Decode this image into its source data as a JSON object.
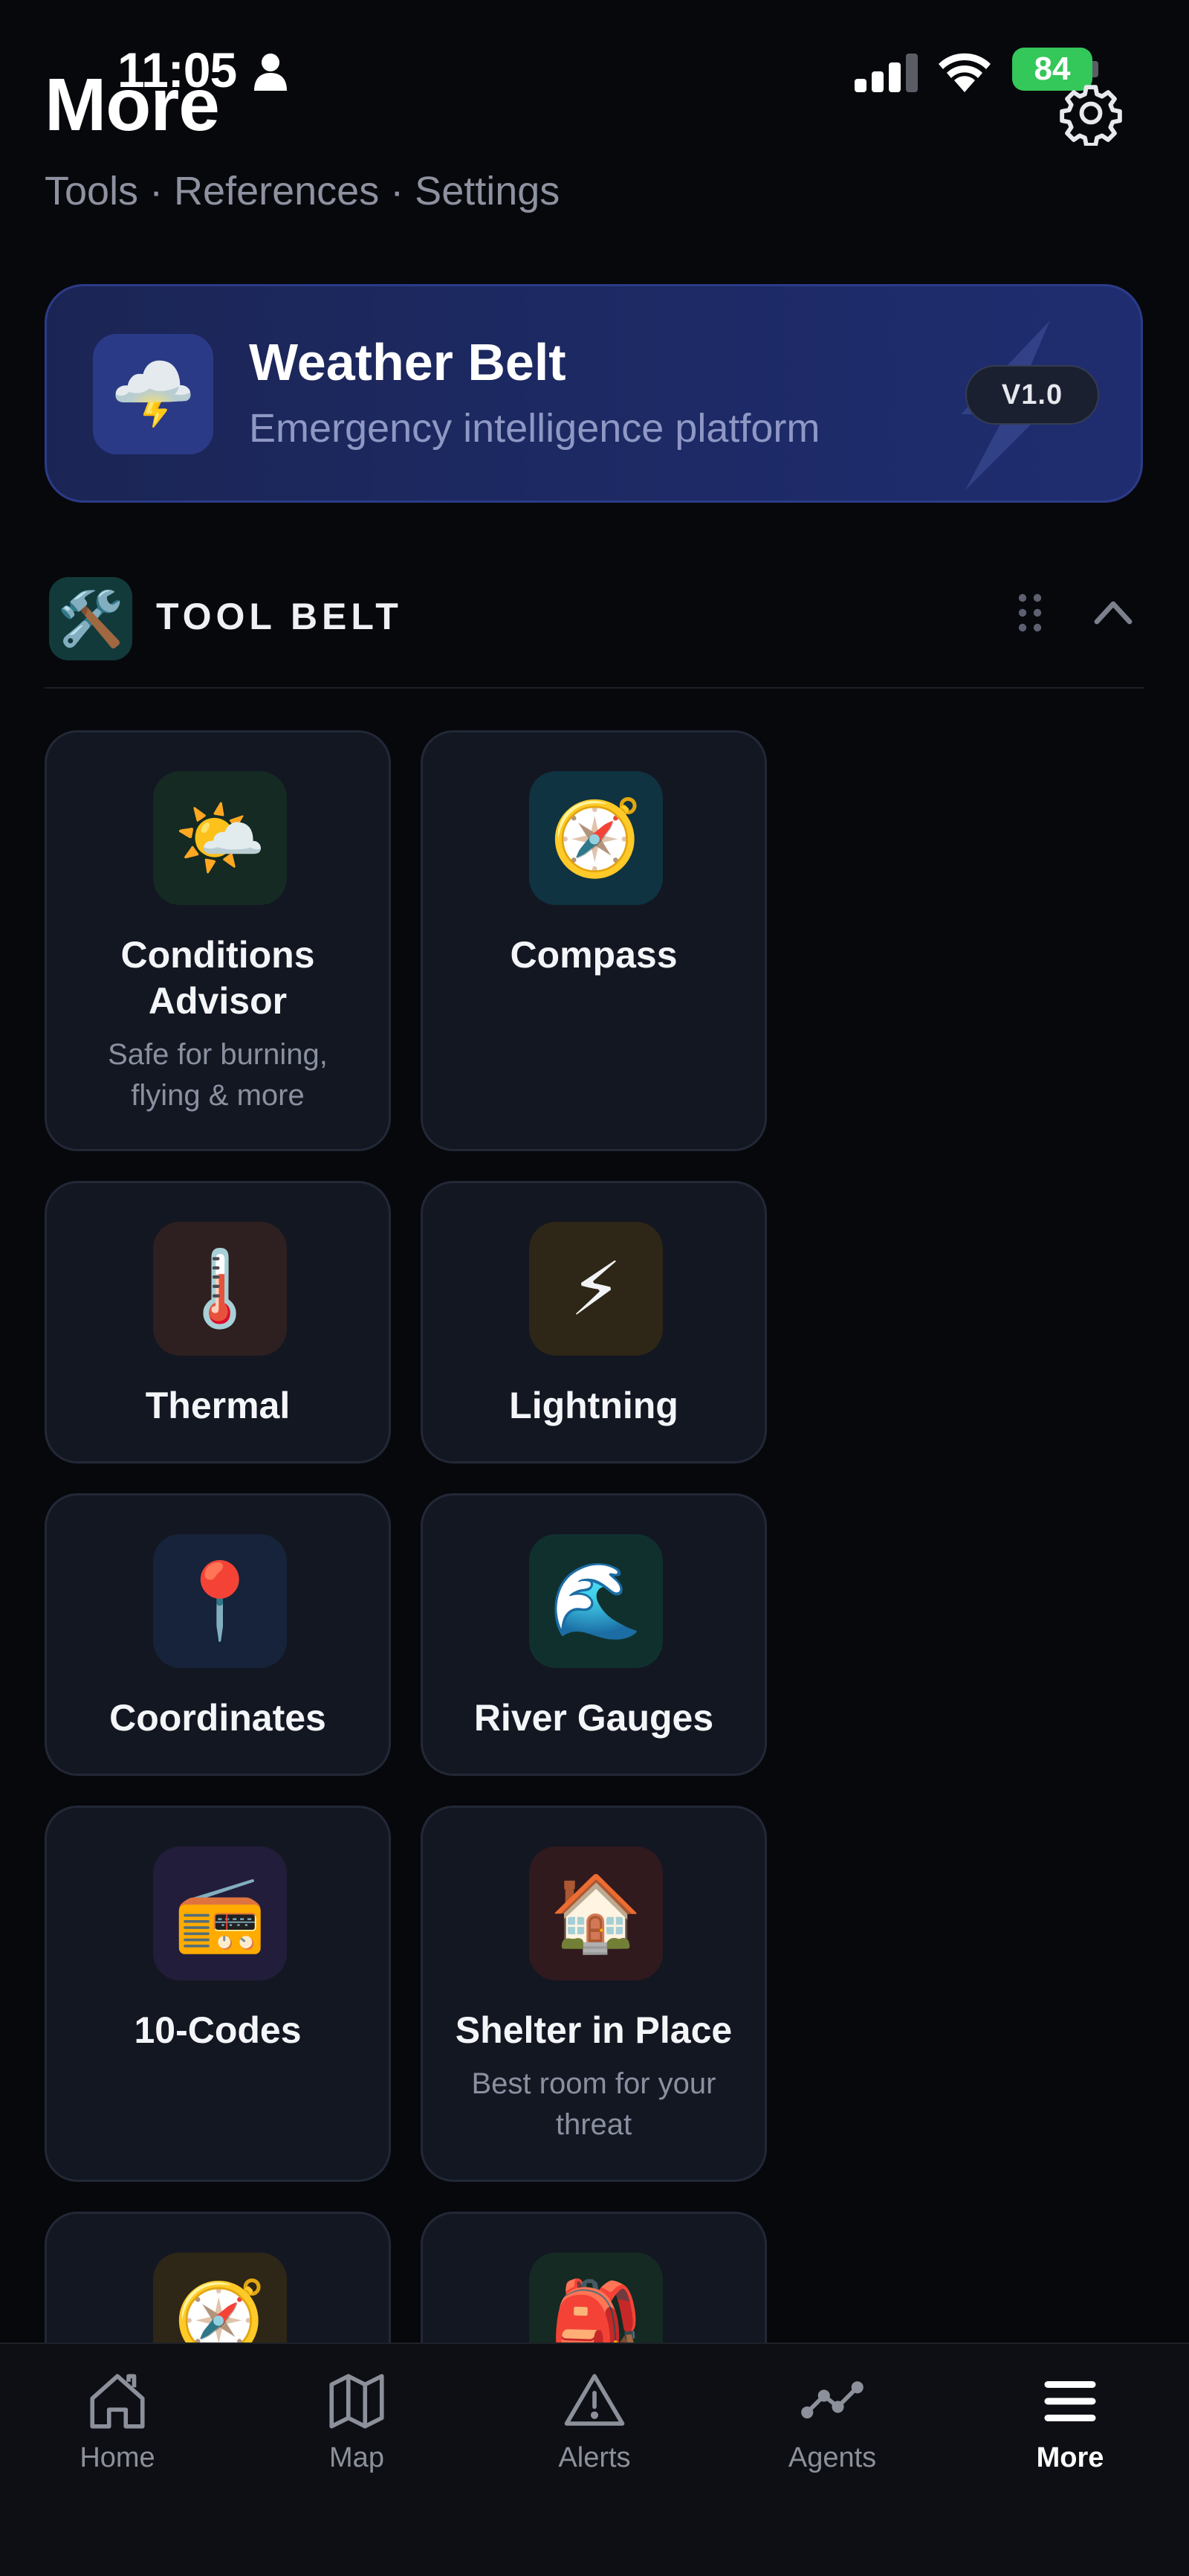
{
  "status_bar": {
    "time": "11:05",
    "battery": "84",
    "icons": [
      "person-icon",
      "cellular-signal-icon",
      "wifi-icon",
      "battery-charging-icon"
    ]
  },
  "header": {
    "title": "More",
    "subtitle": "Tools · References · Settings",
    "settings_icon": "gear-icon"
  },
  "banner": {
    "title": "Weather Belt",
    "subtitle": "Emergency intelligence platform",
    "version": "V1.0",
    "icon": "cloud-lightning-icon",
    "emoji": "🌩️"
  },
  "section": {
    "title": "TOOL BELT",
    "icon": "hammer-wrench-icon",
    "emoji": "🛠️",
    "collapsed": false
  },
  "tools": [
    {
      "name": "Conditions\nAdvisor",
      "desc": "Safe for burning, flying & more",
      "emoji": "🌤️",
      "icon": "sun-cloud-icon",
      "tile": "#142a22"
    },
    {
      "name": "Compass",
      "desc": "",
      "emoji": "🧭",
      "icon": "compass-icon",
      "tile": "#0f3340"
    },
    {
      "name": "Thermal",
      "desc": "",
      "emoji": "🌡️",
      "icon": "thermometer-icon",
      "tile": "#2e2020"
    },
    {
      "name": "Lightning",
      "desc": "",
      "emoji": "⚡",
      "icon": "lightning-icon",
      "tile": "#2e2616"
    },
    {
      "name": "Coordinates",
      "desc": "",
      "emoji": "📍",
      "icon": "pin-icon",
      "tile": "#16233a"
    },
    {
      "name": "River Gauges",
      "desc": "",
      "emoji": "🌊",
      "icon": "wave-icon",
      "tile": "#10302e"
    },
    {
      "name": "10-Codes",
      "desc": "",
      "emoji": "📻",
      "icon": "radio-icon",
      "tile": "#221d3a"
    },
    {
      "name": "Shelter in Place",
      "desc": "Best room for your threat",
      "emoji": "🏠",
      "icon": "house-icon",
      "tile": "#301a1e"
    },
    {
      "name": "",
      "desc": "",
      "emoji": "🧭",
      "icon": "compass-icon",
      "tile": "#2e2616"
    },
    {
      "name": "",
      "desc": "",
      "emoji": "🎒",
      "icon": "backpack-icon",
      "tile": "#142a22"
    }
  ],
  "tabbar": {
    "active": "More",
    "tabs": [
      {
        "label": "Home",
        "icon": "home-icon"
      },
      {
        "label": "Map",
        "icon": "map-icon"
      },
      {
        "label": "Alerts",
        "icon": "alert-triangle-icon"
      },
      {
        "label": "Agents",
        "icon": "agents-graph-icon"
      },
      {
        "label": "More",
        "icon": "menu-icon"
      }
    ]
  }
}
